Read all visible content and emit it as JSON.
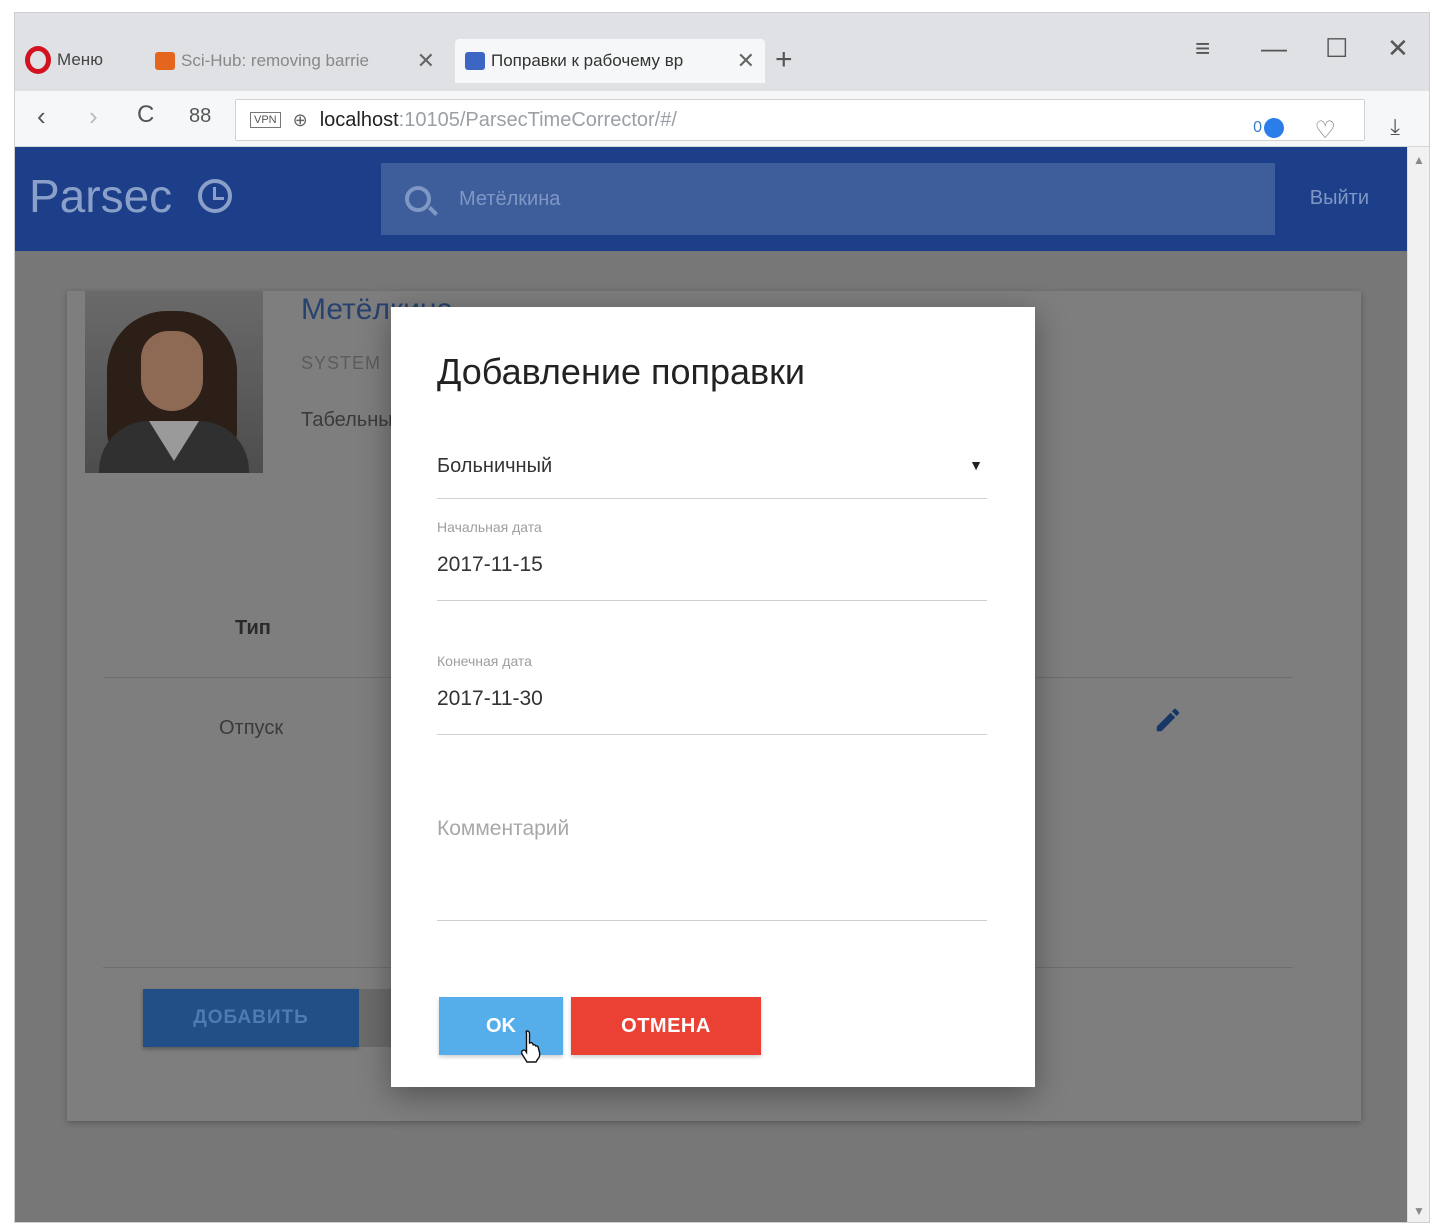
{
  "browser": {
    "menu_label": "Меню",
    "tabs": [
      {
        "title": "Sci-Hub: removing barrie",
        "favicon_color": "#e6651c"
      },
      {
        "title": "Поправки к рабочему вр",
        "favicon_color": "#3b66c4"
      }
    ],
    "new_tab": "+",
    "window_controls": {
      "menu": "≡",
      "minimize": "—",
      "maximize": "☐",
      "close": "✕"
    },
    "nav": {
      "back": "‹",
      "forward": "›",
      "reload": "C",
      "speed_dial": "88"
    },
    "address": {
      "host": "localhost",
      "rest": ":10105/ParsecTimeCorrector/#/",
      "vpn_label": "VPN"
    },
    "adblock_count": "0"
  },
  "app": {
    "brand": "Parsec",
    "search_value": "Метёлкина",
    "logout_label": "Выйти",
    "colors": {
      "header": "#1d3f8a",
      "ok": "#55aeea",
      "cancel": "#eb4034"
    }
  },
  "employee": {
    "name": "Метёлкина",
    "org": "SYSTEM",
    "tab_number_label": "Табельный"
  },
  "table": {
    "header_type": "Тип",
    "rows": [
      {
        "type": "Отпуск"
      }
    ],
    "add_label": "ДОБАВИТЬ"
  },
  "dialog": {
    "title": "Добавление поправки",
    "type_value": "Больничный",
    "start_label": "Начальная дата",
    "start_value": "2017-11-15",
    "end_label": "Конечная дата",
    "end_value": "2017-11-30",
    "comment_placeholder": "Комментарий",
    "ok_label": "OK",
    "cancel_label": "ОТМЕНА"
  }
}
